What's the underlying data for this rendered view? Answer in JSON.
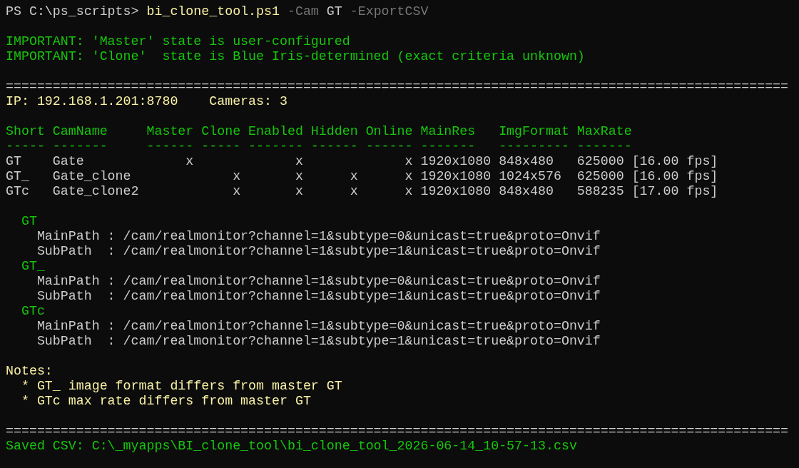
{
  "terminal": {
    "blocks": [
      {
        "lines": [
          [
            {
              "kind": "prompt",
              "text": "PS C:\\ps_scripts> "
            },
            {
              "kind": "command",
              "text": "bi_clone_tool.ps1"
            },
            {
              "kind": "parameter",
              "text": " -Cam"
            },
            {
              "kind": "argument",
              "text": " GT"
            },
            {
              "kind": "parameter",
              "text": " -ExportCSV"
            }
          ]
        ]
      },
      {
        "lines": [
          [
            {
              "kind": "important",
              "text": "IMPORTANT: 'Master' state is user-configured"
            }
          ],
          [
            {
              "kind": "important",
              "text": "IMPORTANT: 'Clone'  state is Blue Iris-determined (exact criteria unknown)"
            }
          ]
        ]
      },
      {
        "lines": [
          [
            {
              "kind": "separator",
              "text": "===================================================================================================="
            }
          ],
          [
            {
              "kind": "info",
              "text": "IP: 192.168.1.201:8780    Cameras: 3"
            }
          ]
        ]
      },
      {
        "lines": [
          [
            {
              "kind": "header",
              "text": "Short CamName     Master Clone Enabled Hidden Online MainRes   ImgFormat MaxRate"
            }
          ],
          [
            {
              "kind": "header",
              "text": "----- -------     ------ ----- ------- ------ ------ -------   --------- -------"
            }
          ],
          [
            {
              "kind": "row",
              "text": "GT    Gate             x             x             x 1920x1080 848x480   625000 [16.00 fps]"
            }
          ],
          [
            {
              "kind": "row",
              "text": "GT_   Gate_clone             x       x      x      x 1920x1080 1024x576  625000 [16.00 fps]"
            }
          ],
          [
            {
              "kind": "row",
              "text": "GTc   Gate_clone2            x       x      x      x 1920x1080 848x480   588235 [17.00 fps]"
            }
          ]
        ]
      },
      {
        "lines": [
          [
            {
              "kind": "camera",
              "text": "  GT"
            }
          ],
          [
            {
              "kind": "path",
              "text": "    MainPath : /cam/realmonitor?channel=1&subtype=0&unicast=true&proto=Onvif"
            }
          ],
          [
            {
              "kind": "path",
              "text": "    SubPath  : /cam/realmonitor?channel=1&subtype=1&unicast=true&proto=Onvif"
            }
          ],
          [
            {
              "kind": "camera",
              "text": "  GT_"
            }
          ],
          [
            {
              "kind": "path",
              "text": "    MainPath : /cam/realmonitor?channel=1&subtype=0&unicast=true&proto=Onvif"
            }
          ],
          [
            {
              "kind": "path",
              "text": "    SubPath  : /cam/realmonitor?channel=1&subtype=1&unicast=true&proto=Onvif"
            }
          ],
          [
            {
              "kind": "camera",
              "text": "  GTc"
            }
          ],
          [
            {
              "kind": "path",
              "text": "    MainPath : /cam/realmonitor?channel=1&subtype=0&unicast=true&proto=Onvif"
            }
          ],
          [
            {
              "kind": "path",
              "text": "    SubPath  : /cam/realmonitor?channel=1&subtype=1&unicast=true&proto=Onvif"
            }
          ]
        ]
      },
      {
        "lines": [
          [
            {
              "kind": "notes",
              "text": "Notes:"
            }
          ],
          [
            {
              "kind": "notes",
              "text": "  * GT_ image format differs from master GT"
            }
          ],
          [
            {
              "kind": "notes",
              "text": "  * GTc max rate differs from master GT"
            }
          ]
        ]
      },
      {
        "lines": [
          [
            {
              "kind": "separator",
              "text": "===================================================================================================="
            }
          ],
          [
            {
              "kind": "saved",
              "text": "Saved CSV: C:\\_myapps\\BI_clone_tool\\bi_clone_tool_2026-06-14_10-57-13.csv"
            }
          ]
        ]
      }
    ]
  }
}
